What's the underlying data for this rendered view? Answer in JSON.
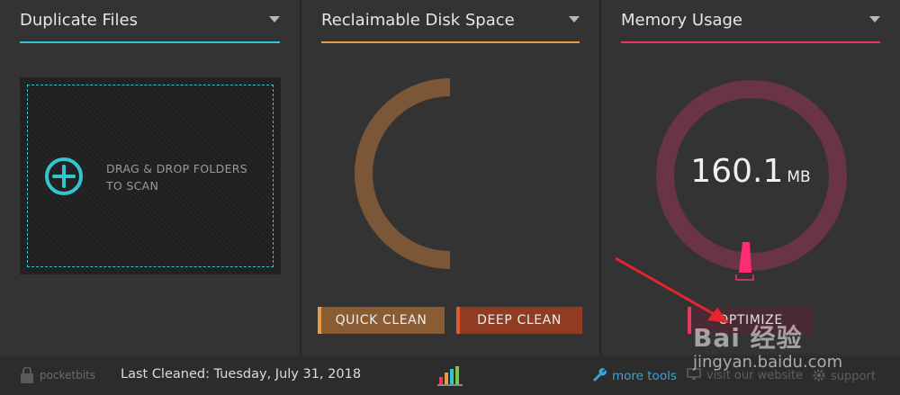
{
  "panels": {
    "duplicate": {
      "title": "Duplicate Files",
      "accent": "#35c5d0",
      "drop_text": "DRAG & DROP FOLDERS TO SCAN"
    },
    "reclaimable": {
      "title": "Reclaimable Disk Space",
      "accent": "#e89a45",
      "quick_clean_label": "QUICK CLEAN",
      "deep_clean_label": "DEEP CLEAN"
    },
    "memory": {
      "title": "Memory Usage",
      "accent": "#e43a62",
      "value": "160.1",
      "unit": "MB",
      "optimize_label": "OPTIMIZE"
    }
  },
  "footer": {
    "brand": "pocketbits",
    "last_cleaned": "Last Cleaned: Tuesday, July 31, 2018",
    "more_tools": "more tools",
    "visit_website": "visit our website",
    "support": "support"
  },
  "watermark": {
    "line1": "Bai 经验",
    "line2": "jingyan.baidu.com"
  },
  "icons": [
    "plus-circle-icon",
    "dropdown-caret-icon",
    "lock-icon",
    "bar-chart-icon",
    "wrench-icon",
    "monitor-icon",
    "gear-icon"
  ]
}
